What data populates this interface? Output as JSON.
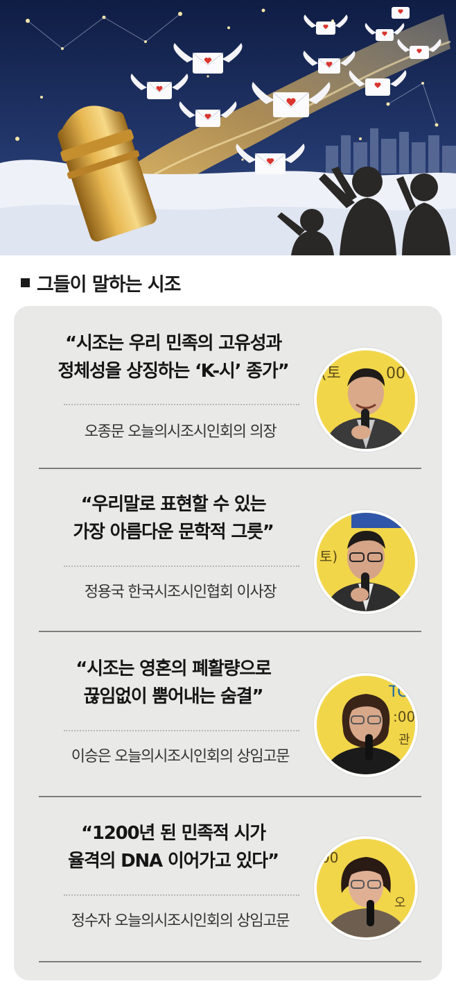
{
  "section": {
    "title": "그들이 말하는 시조"
  },
  "hero": {
    "icon": "illustration-envelopes-night-sky"
  },
  "cards": [
    {
      "quote_line1": "“시조는 우리 민족의 고유성과",
      "quote_line2": "정체성을 상징하는 ‘K-시’ 종가”",
      "byline": "오종문 오늘의시조시인회의 의장"
    },
    {
      "quote_line1": "“우리말로 표현할 수 있는",
      "quote_line2": "가장 아름다운 문학적 그릇”",
      "byline": "정용국 한국시조시인협회 이사장"
    },
    {
      "quote_line1": "“시조는 영혼의 폐활량으로",
      "quote_line2": "끊임없이 뿜어내는 숨결”",
      "byline": "이승은 오늘의시조시인회의 상임고문"
    },
    {
      "quote_line1": "“1200년 된 민족적 시가",
      "quote_line2": "율격의 DNA 이어가고 있다”",
      "byline": "정수자 오늘의시조시인회의 상임고문"
    }
  ],
  "colors": {
    "panel": "#e9e9e8",
    "sky": "#1b2a55",
    "photo_bg": "#f2d64a"
  }
}
